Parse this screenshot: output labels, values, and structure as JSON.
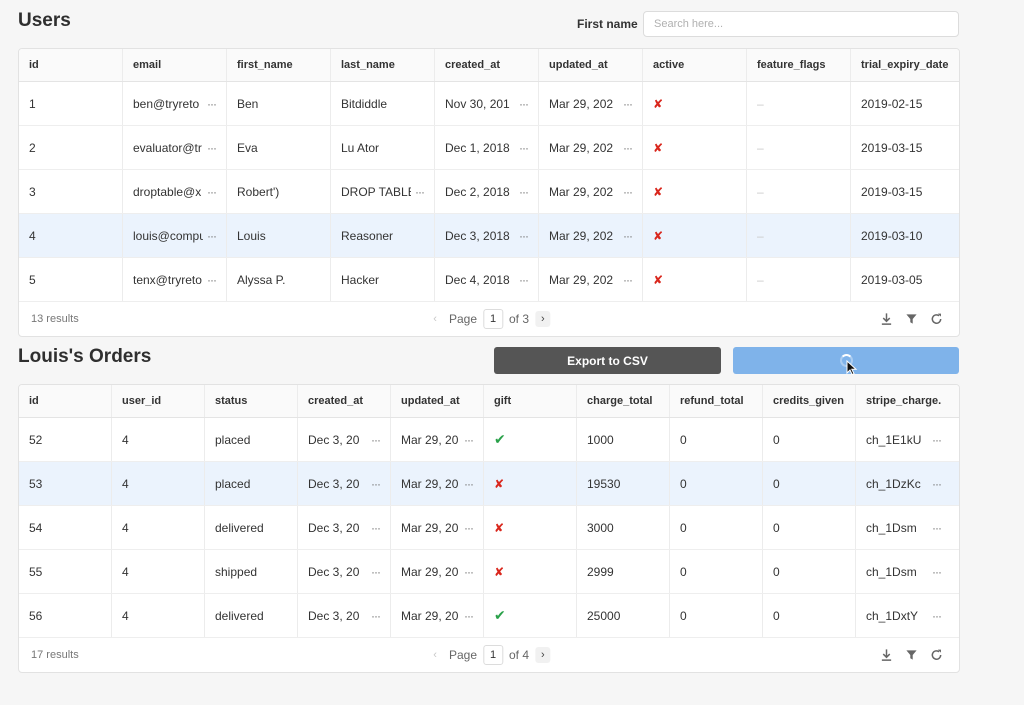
{
  "users_section": {
    "title": "Users",
    "search_label": "First name",
    "search_placeholder": "Search here...",
    "columns": [
      "id",
      "email",
      "first_name",
      "last_name",
      "created_at",
      "updated_at",
      "active",
      "feature_flags",
      "trial_expiry_date"
    ],
    "rows": [
      {
        "id": "1",
        "email": "ben@tryreto",
        "first_name": "Ben",
        "last_name": "Bitdiddle",
        "created_at": "Nov 30, 201",
        "updated_at": "Mar 29, 202",
        "active": false,
        "feature_flags": "–",
        "trial_expiry_date": "2019-02-15"
      },
      {
        "id": "2",
        "email": "evaluator@tr",
        "first_name": "Eva",
        "last_name": "Lu Ator",
        "created_at": "Dec 1, 2018",
        "updated_at": "Mar 29, 202",
        "active": false,
        "feature_flags": "–",
        "trial_expiry_date": "2019-03-15"
      },
      {
        "id": "3",
        "email": "droptable@x",
        "first_name": "Robert')",
        "last_name": "DROP TABLE",
        "created_at": "Dec 2, 2018",
        "updated_at": "Mar 29, 202",
        "active": false,
        "feature_flags": "–",
        "trial_expiry_date": "2019-03-15"
      },
      {
        "id": "4",
        "email": "louis@compu",
        "first_name": "Louis",
        "last_name": "Reasoner",
        "created_at": "Dec 3, 2018",
        "updated_at": "Mar 29, 202",
        "active": false,
        "feature_flags": "–",
        "trial_expiry_date": "2019-03-10",
        "selected": true
      },
      {
        "id": "5",
        "email": "tenx@tryreto",
        "first_name": "Alyssa P.",
        "last_name": "Hacker",
        "created_at": "Dec 4, 2018",
        "updated_at": "Mar 29, 202",
        "active": false,
        "feature_flags": "–",
        "trial_expiry_date": "2019-03-05"
      }
    ],
    "results": "13 results",
    "page_label": "Page",
    "page": "1",
    "of_pages": "of 3"
  },
  "orders_section": {
    "title": "Louis's Orders",
    "export_label": "Export to CSV",
    "columns": [
      "id",
      "user_id",
      "status",
      "created_at",
      "updated_at",
      "gift",
      "charge_total",
      "refund_total",
      "credits_given",
      "stripe_charge..."
    ],
    "rows": [
      {
        "id": "52",
        "user_id": "4",
        "status": "placed",
        "created_at": "Dec 3, 20",
        "updated_at": "Mar 29, 20",
        "gift": true,
        "charge_total": "1000",
        "refund_total": "0",
        "credits_given": "0",
        "stripe_charge": "ch_1E1kU"
      },
      {
        "id": "53",
        "user_id": "4",
        "status": "placed",
        "created_at": "Dec 3, 20",
        "updated_at": "Mar 29, 20",
        "gift": false,
        "charge_total": "19530",
        "refund_total": "0",
        "credits_given": "0",
        "stripe_charge": "ch_1DzKc",
        "selected": true
      },
      {
        "id": "54",
        "user_id": "4",
        "status": "delivered",
        "created_at": "Dec 3, 20",
        "updated_at": "Mar 29, 20",
        "gift": false,
        "charge_total": "3000",
        "refund_total": "0",
        "credits_given": "0",
        "stripe_charge": "ch_1Dsm"
      },
      {
        "id": "55",
        "user_id": "4",
        "status": "shipped",
        "created_at": "Dec 3, 20",
        "updated_at": "Mar 29, 20",
        "gift": false,
        "charge_total": "2999",
        "refund_total": "0",
        "credits_given": "0",
        "stripe_charge": "ch_1Dsm"
      },
      {
        "id": "56",
        "user_id": "4",
        "status": "delivered",
        "created_at": "Dec 3, 20",
        "updated_at": "Mar 29, 20",
        "gift": true,
        "charge_total": "25000",
        "refund_total": "0",
        "credits_given": "0",
        "stripe_charge": "ch_1DxtY"
      }
    ],
    "results": "17 results",
    "page_label": "Page",
    "page": "1",
    "of_pages": "of 4"
  },
  "icons": {
    "download": "download-icon",
    "filter": "filter-icon",
    "refresh": "refresh-icon",
    "ellipsis": "ellipsis-icon",
    "false_mark": "x-mark-icon",
    "true_mark": "check-mark-icon"
  },
  "colors": {
    "export_button": "#555555",
    "loading_button": "#7fb3ea",
    "selected_row": "#ebf3fd",
    "false_mark": "#d9261c",
    "true_mark": "#2aa14a"
  }
}
